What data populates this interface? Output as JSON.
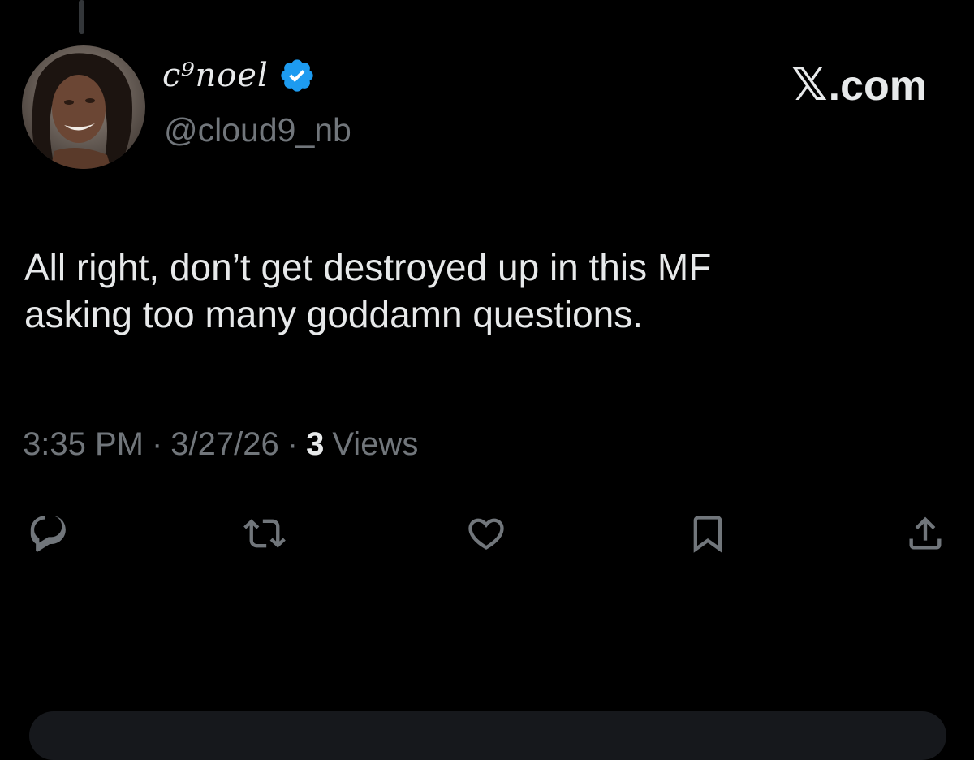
{
  "author": {
    "display_name": "c⁹noel",
    "handle": "@cloud9_nb",
    "verified": true
  },
  "brand": {
    "x_mark": "𝕏",
    "suffix": ".com"
  },
  "tweet": {
    "text": "All right, don’t get destroyed up in this MF\nasking too many goddamn questions."
  },
  "meta": {
    "time": "3:35 PM",
    "separator": "·",
    "date": "3/27/26",
    "views_count": "3",
    "views_label": "Views"
  },
  "actions": [
    {
      "name": "reply",
      "icon": "reply-icon"
    },
    {
      "name": "retweet",
      "icon": "retweet-icon"
    },
    {
      "name": "like",
      "icon": "heart-icon"
    },
    {
      "name": "bookmark",
      "icon": "bookmark-icon"
    },
    {
      "name": "share",
      "icon": "share-icon"
    }
  ],
  "colors": {
    "background": "#000000",
    "primary_text": "#e7e9ea",
    "secondary_text": "#71767b",
    "verified_badge": "#1d9bf0"
  }
}
